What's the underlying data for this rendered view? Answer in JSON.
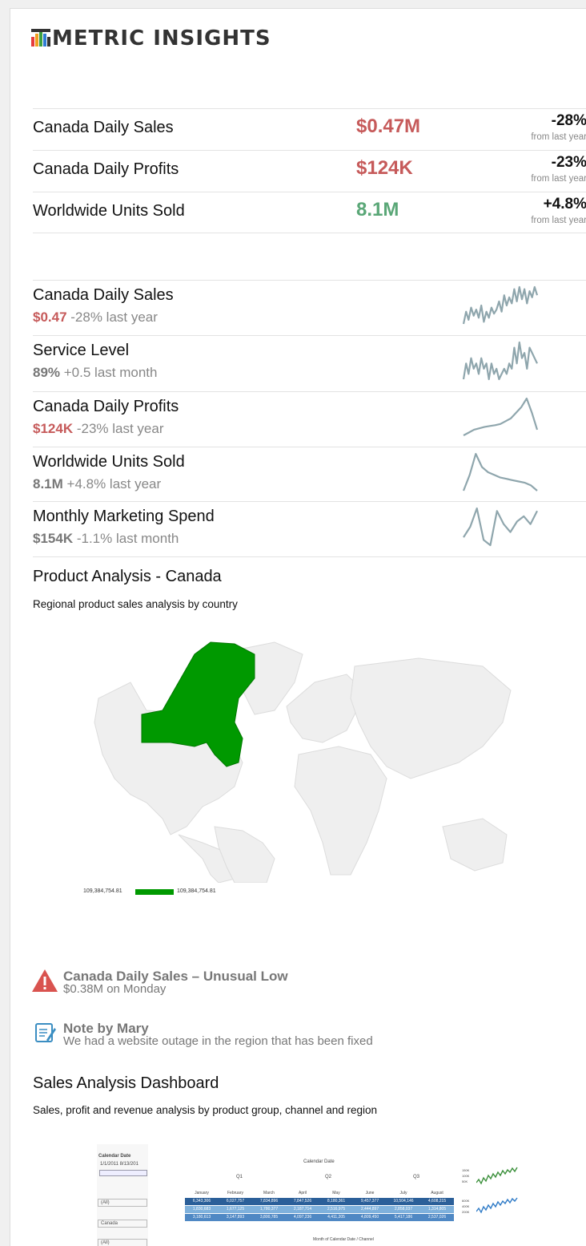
{
  "brand": {
    "name": "METRIC INSIGHTS"
  },
  "kpis": [
    {
      "name": "Canada  Daily Sales",
      "value": "$0.47M",
      "change": "-28%",
      "sub": "from last year",
      "color": "red"
    },
    {
      "name": "Canada  Daily Profits",
      "value": "$124K",
      "change": "-23%",
      "sub": "from last year",
      "color": "red"
    },
    {
      "name": "Worldwide Units Sold",
      "value": "8.1M",
      "change": "+4.8%",
      "sub": "from last year",
      "color": "green"
    }
  ],
  "sparklines": [
    {
      "name": "Canada  Daily Sales",
      "value": "$0.47",
      "detail": " -28% last year",
      "color": "red",
      "series": [
        3,
        9,
        5,
        11,
        7,
        10,
        6,
        12,
        4,
        9,
        6,
        11,
        8,
        10,
        14,
        9,
        17,
        12,
        16,
        13,
        20,
        14,
        21,
        15,
        20,
        13,
        19,
        16,
        21,
        17
      ]
    },
    {
      "name": "Service Level",
      "value": "89%",
      "detail": " +0.5 last month",
      "color": "grey",
      "series": [
        6,
        9,
        7,
        10,
        8,
        9,
        7,
        10,
        8,
        9,
        6,
        9,
        7,
        8,
        6,
        7,
        8,
        7,
        9,
        8,
        12,
        9,
        13,
        10,
        11,
        8,
        12,
        11,
        10,
        9
      ]
    },
    {
      "name": "Canada  Daily Profits",
      "value": "$124K",
      "detail": " -23% last year",
      "color": "red",
      "series": [
        2,
        3,
        4,
        4.5,
        5,
        5.3,
        5.6,
        6,
        7,
        8,
        10,
        12,
        15,
        10,
        4
      ]
    },
    {
      "name": "Worldwide Units Sold",
      "value": "8.1M",
      "detail": " +4.8% last year",
      "color": "grey",
      "series": [
        3,
        9,
        17,
        12,
        10,
        9,
        8,
        7.5,
        7,
        6.5,
        6,
        5,
        3
      ]
    },
    {
      "name": "Monthly Marketing Spend",
      "value": "$154K",
      "detail": " -1.1% last month",
      "color": "grey",
      "series": [
        4,
        8,
        15,
        3,
        1,
        14,
        9,
        6,
        10,
        12,
        9,
        14
      ]
    }
  ],
  "product_analysis": {
    "title": "Product Analysis - Canada",
    "description": "Regional product sales analysis by country",
    "legend_min": "109,384,754.81",
    "legend_max": "109,384,754.81",
    "highlight_color": "#009900"
  },
  "alerts": [
    {
      "title": "Canada Daily Sales – Unusual Low",
      "desc": "$0.38M on Monday",
      "icon": "warning-icon"
    },
    {
      "title": "Note by Mary",
      "desc": "We had a website outage in the region that has been fixed",
      "icon": "note-icon"
    }
  ],
  "sales_dashboard": {
    "title": "Sales Analysis Dashboard",
    "description": "Sales, profit and revenue analysis by product group, channel and region",
    "filter_label": "Calendar Date",
    "date_range": "1/1/2011  8/13/201",
    "filters": [
      "(All)",
      "Canada",
      "(All)"
    ],
    "table_header": "Calendar Date",
    "quarters": [
      "Q1",
      "Q2",
      "Q3"
    ],
    "months": [
      "January",
      "February",
      "March",
      "April",
      "May",
      "June",
      "July",
      "August"
    ],
    "rows": [
      [
        "6,343,306",
        "6,027,757",
        "7,834,896",
        "7,847,526",
        "8,180,361",
        "9,457,377",
        "10,504,146",
        "4,608,215"
      ],
      [
        "1,830,683",
        "1,677,125",
        "1,780,377",
        "2,187,714",
        "2,516,975",
        "2,444,897",
        "2,858,037",
        "1,314,805"
      ],
      [
        "3,180,613",
        "3,147,893",
        "3,800,785",
        "4,097,236",
        "4,411,205",
        "4,809,450",
        "5,417,186",
        "2,537,026"
      ]
    ],
    "x_caption": "Month of Calendar Date  /  Channel",
    "mini_axis_top": [
      "150K",
      "100K",
      "50K"
    ],
    "mini_axis_bottom": [
      "600K",
      "400K",
      "200K"
    ]
  }
}
